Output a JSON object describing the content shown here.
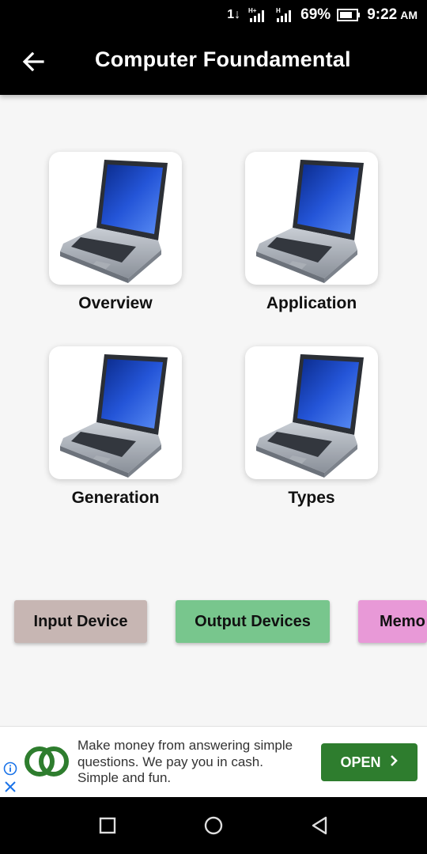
{
  "status_bar": {
    "network": "1↓",
    "signal1": "H+",
    "signal2": "H",
    "battery": "69%",
    "time": "9:22",
    "ampm": "AM"
  },
  "app_bar": {
    "title": "Computer Foundamental",
    "back_icon": "back-arrow-icon"
  },
  "cards": [
    {
      "label": "Overview",
      "icon": "laptop-image"
    },
    {
      "label": "Application",
      "icon": "laptop-image"
    },
    {
      "label": "Generation",
      "icon": "laptop-image"
    },
    {
      "label": "Types",
      "icon": "laptop-image"
    }
  ],
  "buttons": [
    {
      "label": "Input Device",
      "color": "#c7b6b3"
    },
    {
      "label": "Output Devices",
      "color": "#78c68d"
    },
    {
      "label": "Memo",
      "color": "#e899d7"
    }
  ],
  "ad": {
    "text": "Make money from answering simple questions. We pay you in cash. Simple and fun.",
    "cta": "OPEN",
    "logo_color": "#2e7d2e",
    "info_icon": "info-icon",
    "close_icon": "close-icon"
  },
  "nav": [
    "recents-square-icon",
    "home-circle-icon",
    "back-triangle-icon"
  ]
}
